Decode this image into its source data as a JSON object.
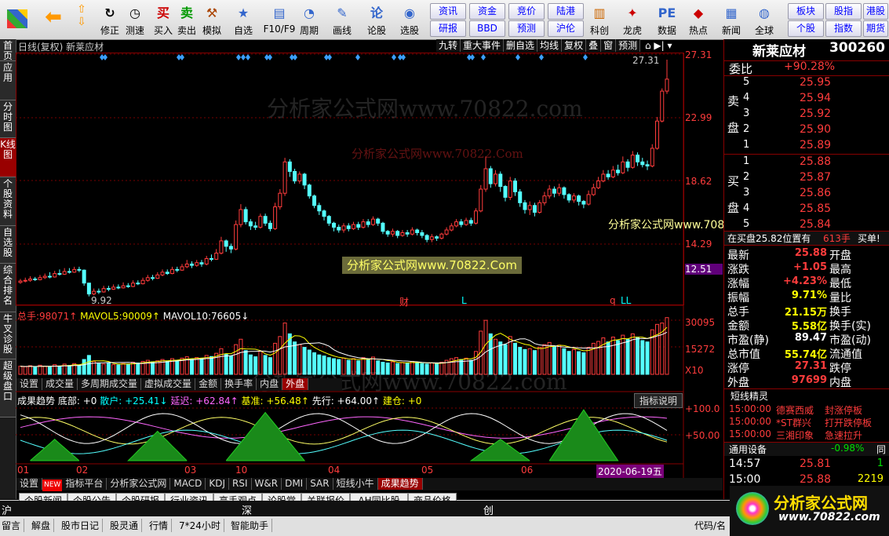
{
  "toolbar": {
    "buttons": [
      {
        "label": "修正",
        "icon": "↻"
      },
      {
        "label": "测速",
        "icon": "◷"
      },
      {
        "label": "买入",
        "icon": "买"
      },
      {
        "label": "卖出",
        "icon": "卖"
      },
      {
        "label": "模拟",
        "icon": "⚒"
      },
      {
        "label": "自选",
        "icon": "★"
      },
      {
        "label": "F10/F9",
        "icon": "▤"
      },
      {
        "label": "周期",
        "icon": "◔"
      },
      {
        "label": "画线",
        "icon": "✎"
      },
      {
        "label": "论股",
        "icon": "论"
      },
      {
        "label": "选股",
        "icon": "◉"
      },
      {
        "label": "科创",
        "icon": "▥"
      },
      {
        "label": "龙虎",
        "icon": "✦"
      },
      {
        "label": "数据",
        "icon": "PE"
      },
      {
        "label": "热点",
        "icon": "◆"
      },
      {
        "label": "新闻",
        "icon": "▦"
      },
      {
        "label": "全球",
        "icon": "◍"
      }
    ],
    "small": [
      "资讯",
      "资金",
      "竞价",
      "陆港",
      "研报",
      "BBD",
      "预测",
      "沪伦",
      "板块",
      "股指",
      "港股",
      "个股",
      "指数",
      "期货"
    ]
  },
  "left_tabs": [
    "首页",
    "应用",
    "分时图",
    "K线图",
    "个股资料",
    "自选股",
    "综合排名",
    "牛叉诊股",
    "超级盘口"
  ],
  "chart": {
    "header_left": "日线(复权)  新莱应材",
    "header_buttons": [
      "九转",
      "重大事件",
      "删自选",
      "均线",
      "复权",
      "叠",
      "窗",
      "预测"
    ],
    "price_labels": [
      "27.31",
      "22.99",
      "18.62",
      "14.29",
      "12.51"
    ],
    "high_label": "27.31",
    "low_label": "9.92",
    "events": [
      "财",
      "L",
      "q",
      "LL"
    ],
    "watermarks": [
      "分析家公式网www.70822.com",
      "分析家公式网www.70822.Com",
      "分析家公式网www.70822.Com",
      "分析家公式网www.70822.com"
    ],
    "vol_header": {
      "total_label": "总手:",
      "total": "98071↑",
      "ma5_label": "MAVOL5:",
      "ma5": "90009↑",
      "ma10_label": "MAVOL10:",
      "ma10": "76605↓"
    },
    "vol_labels": [
      "30095",
      "15272",
      "X10"
    ],
    "vol_tabs": [
      "设置",
      "成交量",
      "多周期成交量",
      "虚拟成交量",
      "金额",
      "换手率",
      "内盘",
      "外盘"
    ],
    "ind_header": {
      "name": "成果趋势",
      "bottom": "底部: +0",
      "scatter": "散户: +25.41↓",
      "delay": "延迟: +62.84↑",
      "base": "基准: +56.48↑",
      "lead": "先行: +64.00↑",
      "build": "建仓: +0"
    },
    "ind_button": "指标说明",
    "ind_labels": [
      "+100.0",
      "+50.00"
    ],
    "dates": [
      "01",
      "02",
      "03",
      "10",
      "04",
      "05",
      "06"
    ],
    "date_highlight": "2020-06-19五",
    "ind_tabs": [
      "设置",
      "指标平台",
      "分析家公式网",
      "MACD",
      "KDJ",
      "RSI",
      "W&R",
      "DMI",
      "SAR",
      "短线小牛",
      "成果趋势"
    ],
    "new_badge": "NEW"
  },
  "candles": [
    [
      10.95,
      11.05,
      11.2,
      10.85
    ],
    [
      11.05,
      11.1,
      11.3,
      10.95
    ],
    [
      11.1,
      11.2,
      11.4,
      11.0
    ],
    [
      11.2,
      11.15,
      11.35,
      11.05
    ],
    [
      11.15,
      11.3,
      11.5,
      11.1
    ],
    [
      11.3,
      11.4,
      11.6,
      11.2
    ],
    [
      11.4,
      11.35,
      11.7,
      11.25
    ],
    [
      11.35,
      11.6,
      11.8,
      11.3
    ],
    [
      11.6,
      11.55,
      11.9,
      11.45
    ],
    [
      11.55,
      11.75,
      12.0,
      11.5
    ],
    [
      11.75,
      11.7,
      12.0,
      11.6
    ],
    [
      11.7,
      11.9,
      12.1,
      11.65
    ],
    [
      11.9,
      11.85,
      12.1,
      11.7
    ],
    [
      11.85,
      10.9,
      11.9,
      10.7
    ],
    [
      10.9,
      10.1,
      10.9,
      9.92
    ],
    [
      10.1,
      10.3,
      10.5,
      10.0
    ],
    [
      10.3,
      10.25,
      10.5,
      10.1
    ],
    [
      10.25,
      10.5,
      10.7,
      10.2
    ],
    [
      10.5,
      10.45,
      10.7,
      10.3
    ],
    [
      10.45,
      10.6,
      10.8,
      10.4
    ],
    [
      10.6,
      10.55,
      10.8,
      10.45
    ],
    [
      10.55,
      10.7,
      10.95,
      10.5
    ],
    [
      10.7,
      10.65,
      10.9,
      10.55
    ],
    [
      10.65,
      10.9,
      11.1,
      10.6
    ],
    [
      10.9,
      10.85,
      11.1,
      10.75
    ],
    [
      10.85,
      11.1,
      11.3,
      10.8
    ],
    [
      11.1,
      11.3,
      11.5,
      11.0
    ],
    [
      11.3,
      11.25,
      11.5,
      11.1
    ],
    [
      11.25,
      11.5,
      11.7,
      11.2
    ],
    [
      11.5,
      11.7,
      11.9,
      11.4
    ],
    [
      11.7,
      11.6,
      11.9,
      11.5
    ],
    [
      11.6,
      11.9,
      12.1,
      11.55
    ],
    [
      11.9,
      11.85,
      12.1,
      11.7
    ],
    [
      11.85,
      12.1,
      12.3,
      11.8
    ],
    [
      12.1,
      12.3,
      12.6,
      12.0
    ],
    [
      12.3,
      12.2,
      12.5,
      12.0
    ],
    [
      12.2,
      12.4,
      12.6,
      12.1
    ],
    [
      12.4,
      12.3,
      12.6,
      12.1
    ],
    [
      12.3,
      12.7,
      12.9,
      12.2
    ],
    [
      12.7,
      12.65,
      13.0,
      12.5
    ],
    [
      12.65,
      13.1,
      13.4,
      12.6
    ],
    [
      13.1,
      14.0,
      14.3,
      13.0
    ],
    [
      14.0,
      13.6,
      14.1,
      13.2
    ],
    [
      13.6,
      13.4,
      13.8,
      13.1
    ],
    [
      13.4,
      15.2,
      15.5,
      13.3
    ],
    [
      15.2,
      16.3,
      16.7,
      15.0
    ],
    [
      16.3,
      15.4,
      16.5,
      15.2
    ],
    [
      15.4,
      15.1,
      15.6,
      14.8
    ],
    [
      15.1,
      15.0,
      15.4,
      14.8
    ],
    [
      15.0,
      15.8,
      16.0,
      14.9
    ],
    [
      15.8,
      15.3,
      16.0,
      15.1
    ],
    [
      15.3,
      14.9,
      15.5,
      14.7
    ],
    [
      14.9,
      16.5,
      16.8,
      14.8
    ],
    [
      16.5,
      17.5,
      17.8,
      16.3
    ],
    [
      17.5,
      19.8,
      20.1,
      17.3
    ],
    [
      19.8,
      19.1,
      20.0,
      18.7
    ],
    [
      19.1,
      18.4,
      19.3,
      18.2
    ],
    [
      18.4,
      18.9,
      19.1,
      18.2
    ],
    [
      18.9,
      18.1,
      19.0,
      17.8
    ],
    [
      18.1,
      17.3,
      18.2,
      17.1
    ],
    [
      17.3,
      16.6,
      17.4,
      16.4
    ],
    [
      16.6,
      16.2,
      16.8,
      15.9
    ],
    [
      16.2,
      15.8,
      16.3,
      15.5
    ],
    [
      15.8,
      15.3,
      15.9,
      15.1
    ],
    [
      15.3,
      15.0,
      15.4,
      14.7
    ],
    [
      15.0,
      14.8,
      15.2,
      14.6
    ],
    [
      14.8,
      15.1,
      15.3,
      14.6
    ],
    [
      15.1,
      14.9,
      15.3,
      14.7
    ],
    [
      14.9,
      15.2,
      15.4,
      14.8
    ],
    [
      15.2,
      15.0,
      15.4,
      14.8
    ],
    [
      15.0,
      15.4,
      15.6,
      14.9
    ],
    [
      15.4,
      15.2,
      15.6,
      15.0
    ],
    [
      15.2,
      15.6,
      15.8,
      15.1
    ],
    [
      15.6,
      15.3,
      15.7,
      15.1
    ],
    [
      15.3,
      14.7,
      15.4,
      14.5
    ],
    [
      14.7,
      14.5,
      14.8,
      14.3
    ],
    [
      14.5,
      14.7,
      14.9,
      14.3
    ],
    [
      14.7,
      14.4,
      14.8,
      14.2
    ],
    [
      14.4,
      14.6,
      14.8,
      14.3
    ],
    [
      14.6,
      14.5,
      14.8,
      14.3
    ],
    [
      14.5,
      14.8,
      15.0,
      14.4
    ],
    [
      14.8,
      14.6,
      14.9,
      14.4
    ],
    [
      14.6,
      14.4,
      14.8,
      14.2
    ],
    [
      14.4,
      14.1,
      14.5,
      13.9
    ],
    [
      14.1,
      14.3,
      14.5,
      13.9
    ],
    [
      14.3,
      14.2,
      14.4,
      14.0
    ],
    [
      14.2,
      14.5,
      14.6,
      14.1
    ],
    [
      14.5,
      14.8,
      15.0,
      14.4
    ],
    [
      14.8,
      15.1,
      15.3,
      14.7
    ],
    [
      15.1,
      15.4,
      15.6,
      15.0
    ],
    [
      15.4,
      15.2,
      15.6,
      15.0
    ],
    [
      15.2,
      15.5,
      15.7,
      15.1
    ],
    [
      15.5,
      15.3,
      15.7,
      15.1
    ],
    [
      15.3,
      16.2,
      16.4,
      15.2
    ],
    [
      16.2,
      17.8,
      18.1,
      16.1
    ],
    [
      17.8,
      19.3,
      20.2,
      17.6
    ],
    [
      19.3,
      18.2,
      19.5,
      17.9
    ],
    [
      18.2,
      18.9,
      19.2,
      18.0
    ],
    [
      18.9,
      18.0,
      19.1,
      17.6
    ],
    [
      18.0,
      17.2,
      18.1,
      16.9
    ],
    [
      17.2,
      18.4,
      18.7,
      17.0
    ],
    [
      18.4,
      17.6,
      18.6,
      17.3
    ],
    [
      17.6,
      16.8,
      17.8,
      16.5
    ],
    [
      16.8,
      16.3,
      17.0,
      16.0
    ],
    [
      16.3,
      16.6,
      16.9,
      15.9
    ],
    [
      16.6,
      16.1,
      16.8,
      15.8
    ],
    [
      16.1,
      16.8,
      17.0,
      16.0
    ],
    [
      16.8,
      17.3,
      17.6,
      16.6
    ],
    [
      17.3,
      17.8,
      18.1,
      17.1
    ],
    [
      17.8,
      17.5,
      18.0,
      17.2
    ],
    [
      17.5,
      17.9,
      18.2,
      17.3
    ],
    [
      17.9,
      17.4,
      18.0,
      17.1
    ],
    [
      17.4,
      17.0,
      17.5,
      16.8
    ],
    [
      17.0,
      17.3,
      17.5,
      16.8
    ],
    [
      17.3,
      16.9,
      17.4,
      16.6
    ],
    [
      16.9,
      16.7,
      17.0,
      16.4
    ],
    [
      16.7,
      17.4,
      17.7,
      16.6
    ],
    [
      17.4,
      17.9,
      18.2,
      17.3
    ],
    [
      17.9,
      18.4,
      18.7,
      17.8
    ],
    [
      18.4,
      18.9,
      19.2,
      18.3
    ],
    [
      18.9,
      18.7,
      19.2,
      18.5
    ],
    [
      18.7,
      19.2,
      19.5,
      18.6
    ],
    [
      19.2,
      19.0,
      19.6,
      18.8
    ],
    [
      19.0,
      19.8,
      20.2,
      18.9
    ],
    [
      19.8,
      19.4,
      20.0,
      19.1
    ],
    [
      19.4,
      20.3,
      20.6,
      19.3
    ],
    [
      20.3,
      19.8,
      20.5,
      19.5
    ],
    [
      19.8,
      19.6,
      20.1,
      19.4
    ],
    [
      19.6,
      19.5,
      19.9,
      19.2
    ],
    [
      19.5,
      20.8,
      21.1,
      19.4
    ],
    [
      20.8,
      22.8,
      23.1,
      20.7
    ],
    [
      22.8,
      25.0,
      25.2,
      22.7
    ],
    [
      25.0,
      25.88,
      27.31,
      24.8
    ]
  ],
  "volumes": [
    30,
    28,
    32,
    26,
    34,
    30,
    27,
    36,
    30,
    38,
    33,
    40,
    35,
    55,
    70,
    48,
    40,
    38,
    42,
    36,
    35,
    40,
    38,
    45,
    42,
    48,
    52,
    46,
    50,
    55,
    48,
    58,
    52,
    60,
    65,
    55,
    62,
    58,
    70,
    66,
    78,
    95,
    75,
    68,
    110,
    130,
    88,
    72,
    65,
    85,
    70,
    62,
    115,
    140,
    190,
    150,
    120,
    110,
    100,
    90,
    80,
    72,
    68,
    62,
    58,
    55,
    60,
    52,
    58,
    50,
    62,
    55,
    64,
    50,
    45,
    42,
    46,
    40,
    44,
    42,
    48,
    44,
    40,
    38,
    42,
    40,
    45,
    52,
    58,
    62,
    55,
    60,
    52,
    85,
    160,
    200,
    150,
    130,
    120,
    110,
    140,
    115,
    100,
    92,
    95,
    88,
    100,
    110,
    118,
    102,
    108,
    95,
    85,
    92,
    84,
    80,
    100,
    115,
    122,
    135,
    120,
    138,
    125,
    145,
    130,
    150,
    138,
    125,
    120,
    165,
    185,
    190,
    210
  ]
}
